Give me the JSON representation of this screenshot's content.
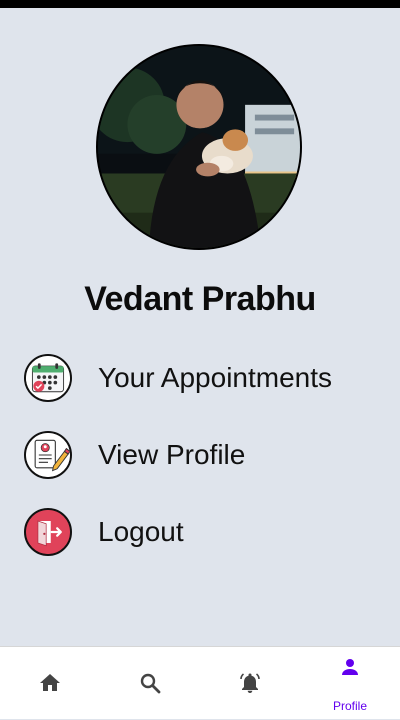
{
  "profile": {
    "name": "Vedant Prabhu"
  },
  "menu": [
    {
      "label": "Your Appointments",
      "icon": "calendar-check-icon"
    },
    {
      "label": "View Profile",
      "icon": "profile-document-edit-icon"
    },
    {
      "label": "Logout",
      "icon": "logout-door-icon"
    }
  ],
  "bottom_nav": {
    "items": [
      {
        "icon": "home-icon"
      },
      {
        "icon": "search-icon"
      },
      {
        "icon": "notification-bell-icon"
      },
      {
        "icon": "person-icon",
        "label": "Profile",
        "active": true
      }
    ]
  },
  "colors": {
    "background": "#dfe4ec",
    "accent": "#6200ee",
    "logout": "#e0435a"
  }
}
